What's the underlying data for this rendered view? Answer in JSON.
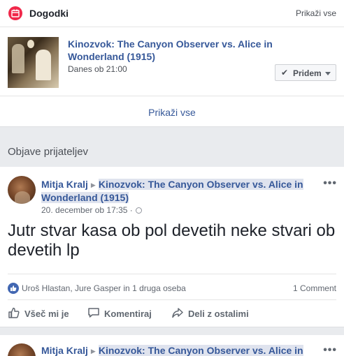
{
  "events": {
    "title": "Dogodki",
    "see_all_top": "Prikaži vse",
    "item": {
      "name": "Kinozvok: The Canyon Observer vs. Alice in Wonderland (1915)",
      "time": "Danes ob 21:00",
      "going_label": "Pridem"
    },
    "see_all_bottom": "Prikaži vse"
  },
  "friends_section": {
    "title": "Objave prijateljev"
  },
  "post": {
    "author": "Mitja Kralj",
    "event_link": "Kinozvok: The Canyon Observer vs. Alice in Wonderland (1915)",
    "timestamp": "20. december ob 17:35 ·",
    "text": "Jutr stvar kasa ob pol devetih neke stvari ob devetih lp",
    "reactions_text": "Uroš Hlastan, Jure Gasper in 1 druga oseba",
    "comment_count": "1 Comment",
    "actions": {
      "like": "Všeč mi je",
      "comment": "Komentiraj",
      "share": "Deli z ostalimi"
    }
  },
  "post2": {
    "author": "Mitja Kralj",
    "event_link": "Kinozvok: The Canyon Observer vs. Alice in"
  },
  "colors": {
    "link": "#365899",
    "calendar_icon": "#f0284a",
    "like_blue": "#4267b2",
    "page_bg": "#e9ebee"
  },
  "icons": [
    "calendar-icon",
    "check-icon",
    "caret-down-icon",
    "globe-icon",
    "more-icon",
    "like-icon",
    "thumbs-up-icon",
    "comment-icon",
    "share-icon"
  ]
}
